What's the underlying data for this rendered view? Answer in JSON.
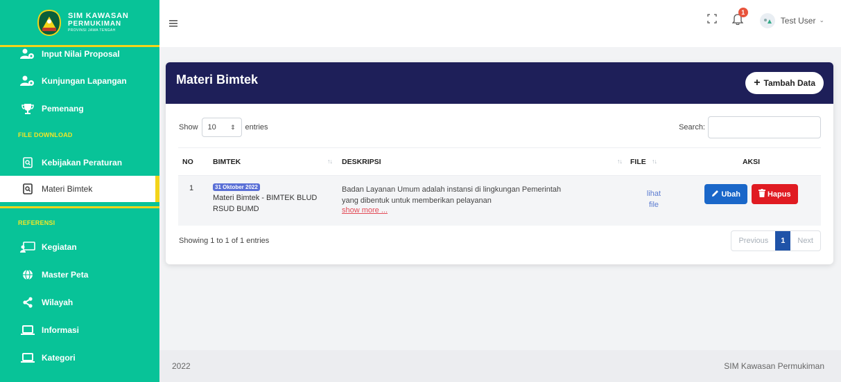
{
  "brand": {
    "line1": "SIM KAWASAN",
    "line2": "PERMUKIMAN",
    "line3": "PROVINSI JAWA TENGAH"
  },
  "sidebar": {
    "items_top": [
      {
        "label": "Input Nilai Proposal",
        "icon": "users-cog-icon"
      },
      {
        "label": "Kunjungan Lapangan",
        "icon": "users-cog-icon"
      },
      {
        "label": "Pemenang",
        "icon": "trophy-icon"
      }
    ],
    "section_download": "FILE DOWNLOAD",
    "items_download": [
      {
        "label": "Kebijakan Peraturan",
        "icon": "file-search-icon"
      },
      {
        "label": "Materi Bimtek",
        "icon": "file-search-icon"
      }
    ],
    "section_referensi": "REFERENSI",
    "items_referensi": [
      {
        "label": "Kegiatan",
        "icon": "presentation-icon"
      },
      {
        "label": "Master Peta",
        "icon": "globe-icon"
      },
      {
        "label": "Wilayah",
        "icon": "share-icon"
      },
      {
        "label": "Informasi",
        "icon": "laptop-icon"
      },
      {
        "label": "Kategori",
        "icon": "laptop-icon"
      }
    ]
  },
  "topbar": {
    "notif_count": "1",
    "user_name": "Test User"
  },
  "card": {
    "title": "Materi Bimtek",
    "add_label": "Tambah Data",
    "show_label": "Show",
    "entries_value": "10",
    "entries_label": "entries",
    "search_label": "Search:",
    "columns": {
      "no": "NO",
      "bimtek": "BIMTEK",
      "deskripsi": "DESKRIPSI",
      "file": "FILE",
      "aksi": "AKSI"
    },
    "rows": [
      {
        "no": "1",
        "date": "31 Oktober 2022",
        "bimtek_line1": "Materi Bimtek - BIMTEK BLUD",
        "bimtek_line2": "RSUD BUMD",
        "desc_line1": "Badan Layanan Umum adalah instansi di lingkungan Pemerintah",
        "desc_line2": "yang dibentuk untuk memberikan pelayanan",
        "show_more": "show more ...",
        "file_line1": "lihat",
        "file_line2": "file",
        "edit_label": "Ubah",
        "delete_label": "Hapus"
      }
    ],
    "info": "Showing 1 to 1 of 1 entries",
    "pager": {
      "prev": "Previous",
      "current": "1",
      "next": "Next"
    }
  },
  "footer": {
    "year": "2022",
    "app_name": "SIM Kawasan Permukiman"
  },
  "colors": {
    "sidebar": "#08c398",
    "accent": "#f3d41a",
    "card_header": "#1e1f59",
    "edit": "#1a67c9",
    "delete": "#e01b22"
  }
}
